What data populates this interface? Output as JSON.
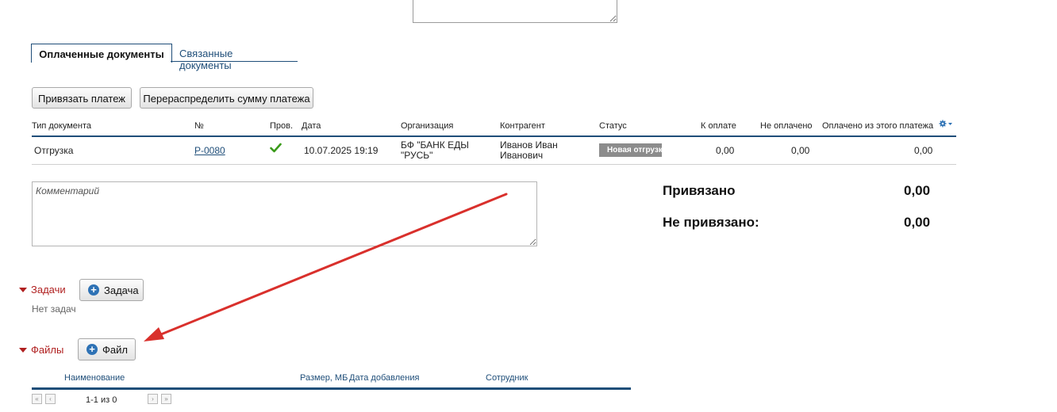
{
  "tabs": {
    "paid_docs": "Оплаченные документы",
    "linked_docs": "Связанные документы"
  },
  "actions": {
    "bind_payment": "Привязать платеж",
    "redistribute": "Перераспределить сумму платежа"
  },
  "table": {
    "headers": {
      "doc_type": "Тип документа",
      "number": "№",
      "checked": "Пров.",
      "date": "Дата",
      "org": "Организация",
      "counterparty": "Контрагент",
      "status": "Статус",
      "to_pay": "К оплате",
      "unpaid": "Не оплачено",
      "paid_from_this": "Оплачено из этого платежа"
    },
    "rows": [
      {
        "doc_type": "Отгрузка",
        "number": "Р-0080",
        "date": "10.07.2025 19:19",
        "org_line1": "БФ \"БАНК ЕДЫ",
        "org_line2": "\"РУСЬ\"",
        "cp_line1": "Иванов Иван",
        "cp_line2": "Иванович",
        "status": "Новая отгрузка",
        "to_pay": "0,00",
        "unpaid": "0,00",
        "paid_from_this": "0,00"
      }
    ]
  },
  "comment": {
    "placeholder": "Комментарий",
    "value": ""
  },
  "summary": {
    "bound_label": "Привязано",
    "bound_value": "0,00",
    "unbound_label": "Не привязано:",
    "unbound_value": "0,00"
  },
  "tasks": {
    "title": "Задачи",
    "add_label": "Задача",
    "empty": "Нет задач"
  },
  "files": {
    "title": "Файлы",
    "add_label": "Файл",
    "headers": {
      "name": "Наименование",
      "size": "Размер, МБ",
      "added": "Дата добавления",
      "employee": "Сотрудник"
    },
    "pager": "1-1 из 0"
  },
  "icons": {
    "check": "check-icon",
    "gear": "gear-icon",
    "plus": "plus-circle-icon",
    "expand": "triangle-down-icon",
    "pager": [
      "first-page-icon",
      "prev-page-icon",
      "next-page-icon",
      "last-page-icon"
    ]
  },
  "colors": {
    "accent": "#1f4e79",
    "section": "#b02020",
    "check": "#3a9a1a",
    "arrow": "#d9302c",
    "badge": "#8c8c8c"
  }
}
